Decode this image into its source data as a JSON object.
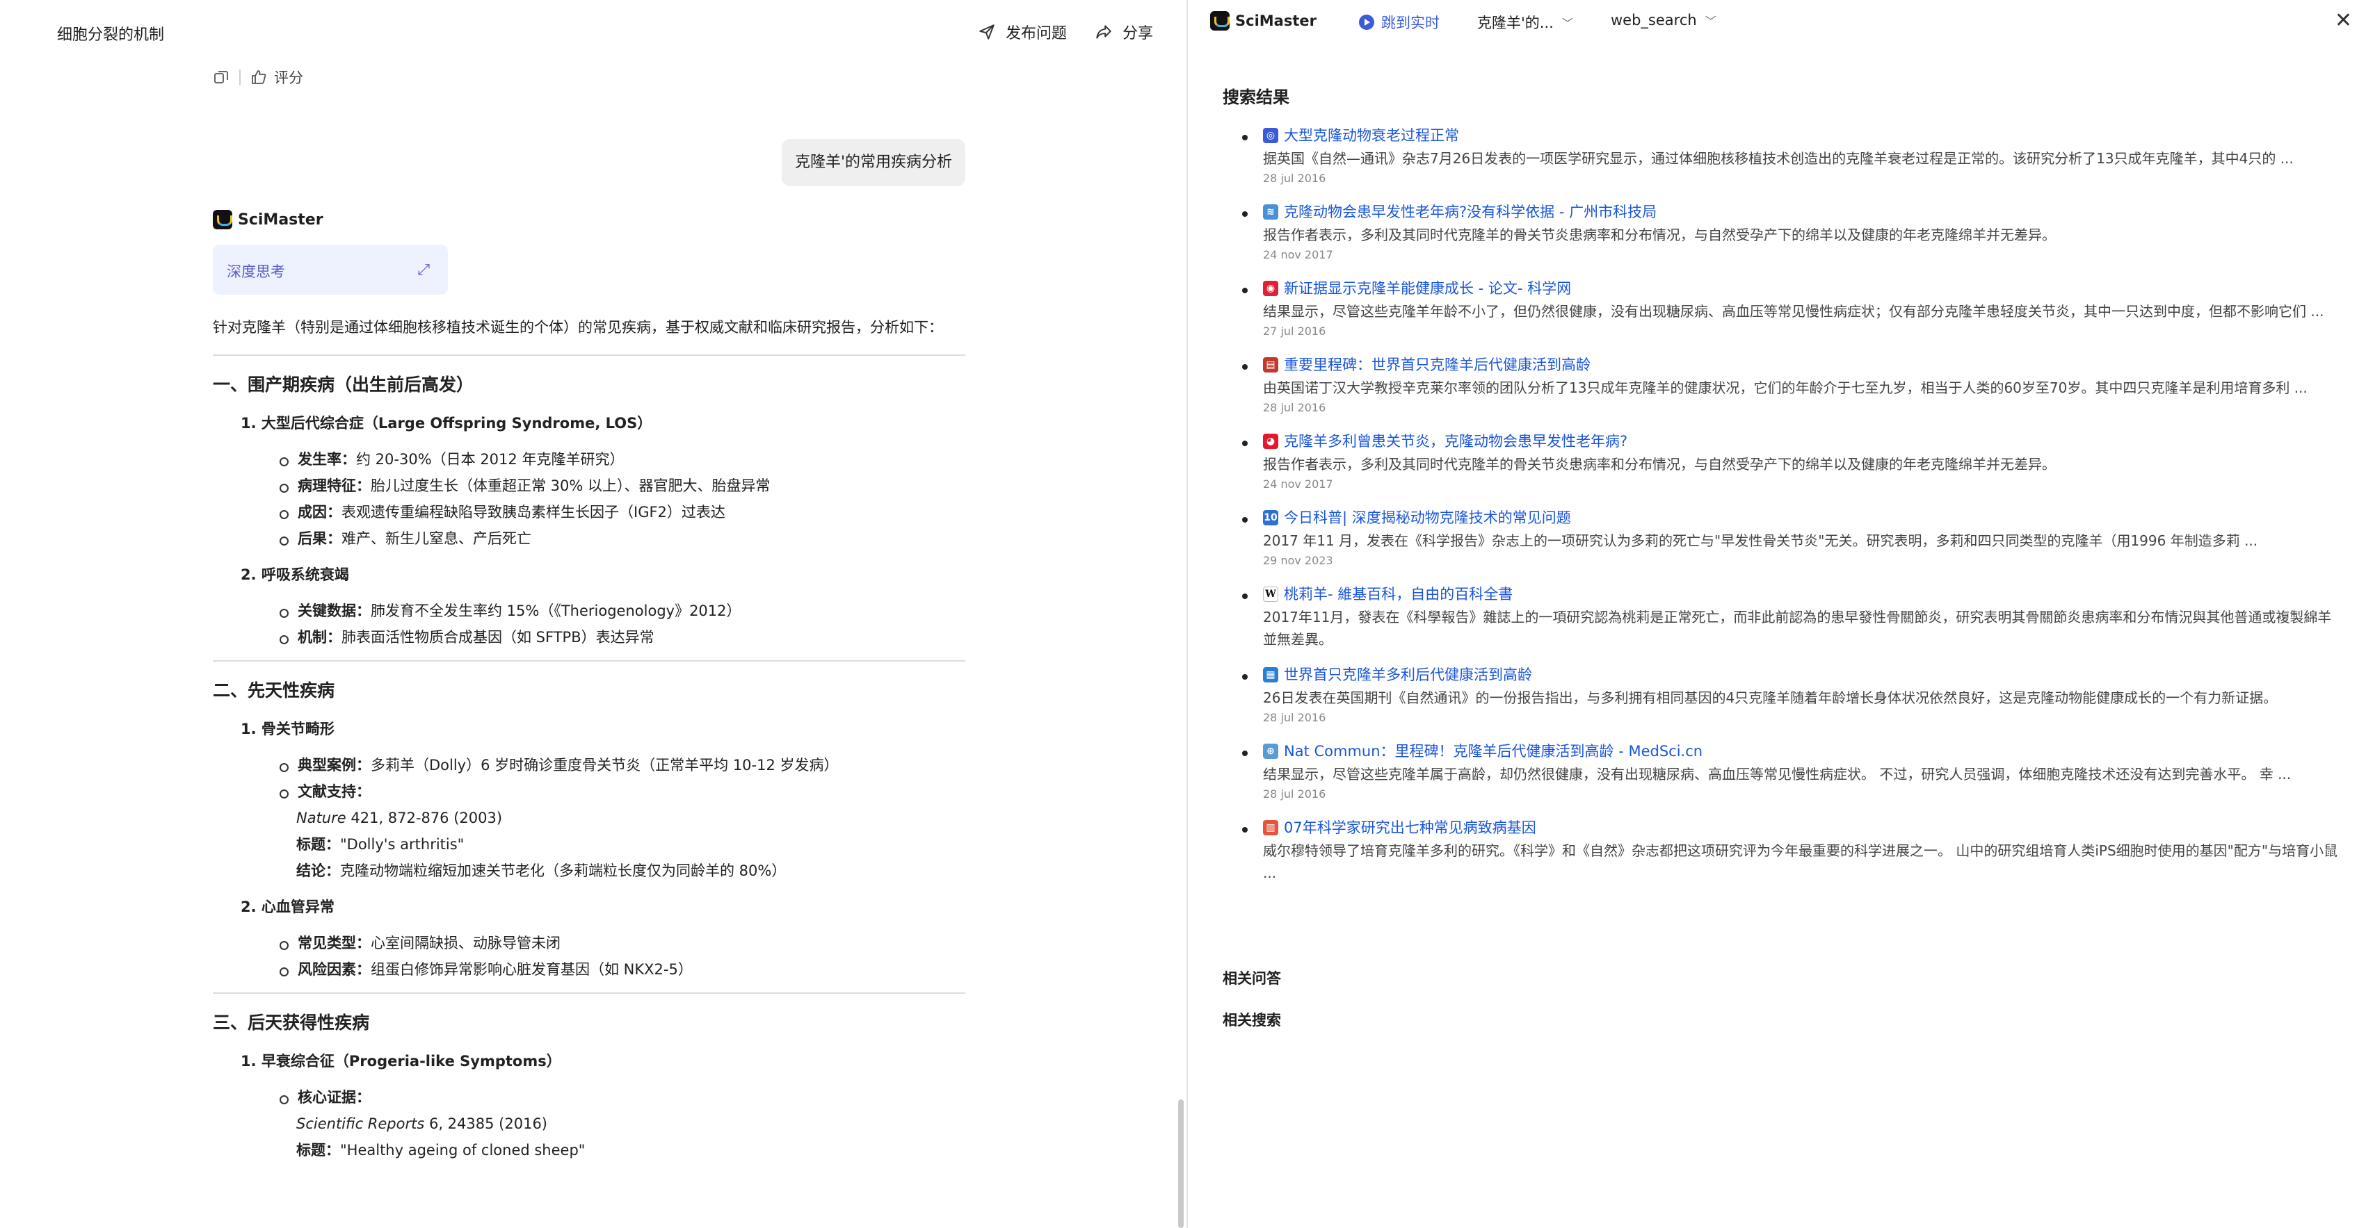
{
  "left": {
    "doc_title": "细胞分裂的机制",
    "publish_label": "发布问题",
    "share_label": "分享",
    "rate_label": "评分",
    "user_question": "克隆羊'的常用疾病分析",
    "brand": "SciMaster",
    "deep_think_label": "深度思考",
    "intro": "针对克隆羊（特别是通过体细胞核移植技术诞生的个体）的常见疾病，基于权威文献和临床研究报告，分析如下：",
    "section1": {
      "title": "一、围产期疾病（出生前后高发）",
      "item1_title": "1. 大型后代综合症（Large Offspring Syndrome, LOS）",
      "item1_bullets": [
        {
          "k": "发生率：",
          "v": "约 20-30%（日本 2012 年克隆羊研究）"
        },
        {
          "k": "病理特征：",
          "v": "胎儿过度生长（体重超正常 30% 以上）、器官肥大、胎盘异常"
        },
        {
          "k": "成因：",
          "v": "表观遗传重编程缺陷导致胰岛素样生长因子（IGF2）过表达"
        },
        {
          "k": "后果：",
          "v": "难产、新生儿窒息、产后死亡"
        }
      ],
      "item2_title": "2. 呼吸系统衰竭",
      "item2_bullets": [
        {
          "k": "关键数据：",
          "v": "肺发育不全发生率约 15%（《Theriogenology》2012）"
        },
        {
          "k": "机制：",
          "v": "肺表面活性物质合成基因（如 SFTPB）表达异常"
        }
      ]
    },
    "section2": {
      "title": "二、先天性疾病",
      "item1_title": "1. 骨关节畸形",
      "case_k": "典型案例：",
      "case_v": "多莉羊（Dolly）6 岁时确诊重度骨关节炎（正常羊平均 10-12 岁发病）",
      "lit_k": "文献支持：",
      "lit_journal": "Nature",
      "lit_ref": " 421, 872-876 (2003)",
      "lit_title_k": "标题：",
      "lit_title_v": "\"Dolly's arthritis\"",
      "lit_concl_k": "结论：",
      "lit_concl_v": "克隆动物端粒缩短加速关节老化（多莉端粒长度仅为同龄羊的 80%）",
      "item2_title": "2. 心血管异常",
      "item2_bullets": [
        {
          "k": "常见类型：",
          "v": "心室间隔缺损、动脉导管未闭"
        },
        {
          "k": "风险因素：",
          "v": "组蛋白修饰异常影响心脏发育基因（如 NKX2-5）"
        }
      ]
    },
    "section3": {
      "title": "三、后天获得性疾病",
      "item1_title": "1. 早衰综合征（Progeria-like Symptoms）",
      "core_k": "核心证据：",
      "core_journal": "Scientific Reports",
      "core_ref": " 6, 24385 (2016)",
      "core_title_k": "标题：",
      "core_title_v": "\"Healthy ageing of cloned sheep\""
    }
  },
  "right": {
    "brand": "SciMaster",
    "live_label": "跳到实时",
    "dropdown1": "克隆羊'的...",
    "dropdown2": "web_search",
    "results_heading": "搜索结果",
    "results": [
      {
        "icon": "globe-icon",
        "fav_color": "#3b5bdb",
        "fav": "◎",
        "title": "大型克隆动物衰老过程正常",
        "snippet": "据英国《自然—通讯》杂志7月26日发表的一项医学研究显示，通过体细胞核移植技术创造出的克隆羊衰老过程是正常的。该研究分析了13只成年克隆羊，其中4只的 ...",
        "date": "28 jul 2016"
      },
      {
        "icon": "gz-science-icon",
        "fav_color": "#4a90d9",
        "fav": "≋",
        "title": "克隆动物会患早发性老年病?没有科学依据 - 广州市科技局",
        "snippet": "报告作者表示，多利及其同时代克隆羊的骨关节炎患病率和分布情况，与自然受孕产下的绵羊以及健康的年老克隆绵羊并无差异。",
        "date": "24 nov 2017"
      },
      {
        "icon": "kexue-icon",
        "fav_color": "#d23",
        "fav": "◉",
        "title": "新证据显示克隆羊能健康成长 - 论文- 科学网",
        "snippet": "结果显示，尽管这些克隆羊年龄不小了，但仍然很健康，没有出现糖尿病、高血压等常见慢性病症状；仅有部分克隆羊患轻度关节炎，其中一只达到中度，但都不影响它们 ...",
        "date": "27 jul 2016"
      },
      {
        "icon": "news-icon",
        "fav_color": "#c0392b",
        "fav": "▤",
        "title": "重要里程碑：世界首只克隆羊后代健康活到高龄",
        "snippet": "由英国诺丁汉大学教授辛克莱尔率领的团队分析了13只成年克隆羊的健康状况，它们的年龄介于七至九岁，相当于人类的60岁至70岁。其中四只克隆羊是利用培育多利 ...",
        "date": "28 jul 2016"
      },
      {
        "icon": "weibo-icon",
        "fav_color": "#e6162d",
        "fav": "◕",
        "title": "克隆羊多利曾患关节炎，克隆动物会患早发性老年病?",
        "snippet": "报告作者表示，多利及其同时代克隆羊的骨关节炎患病率和分布情况，与自然受孕产下的绵羊以及健康的年老克隆绵羊并无差异。",
        "date": "24 nov 2017"
      },
      {
        "icon": "toutiao-icon",
        "fav_color": "#2f6fd6",
        "fav": "10",
        "title": "今日科普| 深度揭秘动物克隆技术的常见问题",
        "snippet": "2017 年11 月，发表在《科学报告》杂志上的一项研究认为多莉的死亡与\"早发性骨关节炎\"无关。研究表明，多莉和四只同类型的克隆羊（用1996 年制造多莉 ...",
        "date": "29 nov 2023"
      },
      {
        "icon": "wikipedia-icon",
        "fav_color": "#ffffff",
        "fav": "W",
        "title": "桃莉羊- 維基百科，自由的百科全書",
        "snippet": "2017年11月，發表在《科學報告》雜誌上的一項研究認為桃莉是正常死亡，而非此前認為的患早發性骨關節炎，研究表明其骨關節炎患病率和分布情況與其他普通或複製綿羊並無差異。",
        "date": ""
      },
      {
        "icon": "gov-icon",
        "fav_color": "#2a7fd4",
        "fav": "▦",
        "title": "世界首只克隆羊多利后代健康活到高龄",
        "snippet": "26日发表在英国期刊《自然通讯》的一份报告指出，与多利拥有相同基因的4只克隆羊随着年龄增长身体状况依然良好，这是克隆动物能健康成长的一个有力新证据。",
        "date": "28 jul 2016"
      },
      {
        "icon": "medsci-icon",
        "fav_color": "#5a9bd5",
        "fav": "⊕",
        "title": "Nat Commun：里程碑！克隆羊后代健康活到高龄 - MedSci.cn",
        "snippet": "结果显示，尽管这些克隆羊属于高龄，却仍然很健康，没有出现糖尿病、高血压等常见慢性病症状。 不过，研究人员强调，体细胞克隆技术还没有达到完善水平。 幸 ...",
        "date": "28 jul 2016"
      },
      {
        "icon": "sohu-icon",
        "fav_color": "#e8533f",
        "fav": "▥",
        "title": "07年科学家研究出七种常见病致病基因",
        "snippet": "威尔穆特领导了培育克隆羊多利的研究。《科学》和《自然》杂志都把这项研究评为今年最重要的科学进展之一。 山中的研究组培育人类iPS细胞时使用的基因\"配方\"与培育小鼠 ...",
        "date": ""
      }
    ],
    "related_qa": "相关问答",
    "related_search": "相关搜索"
  }
}
